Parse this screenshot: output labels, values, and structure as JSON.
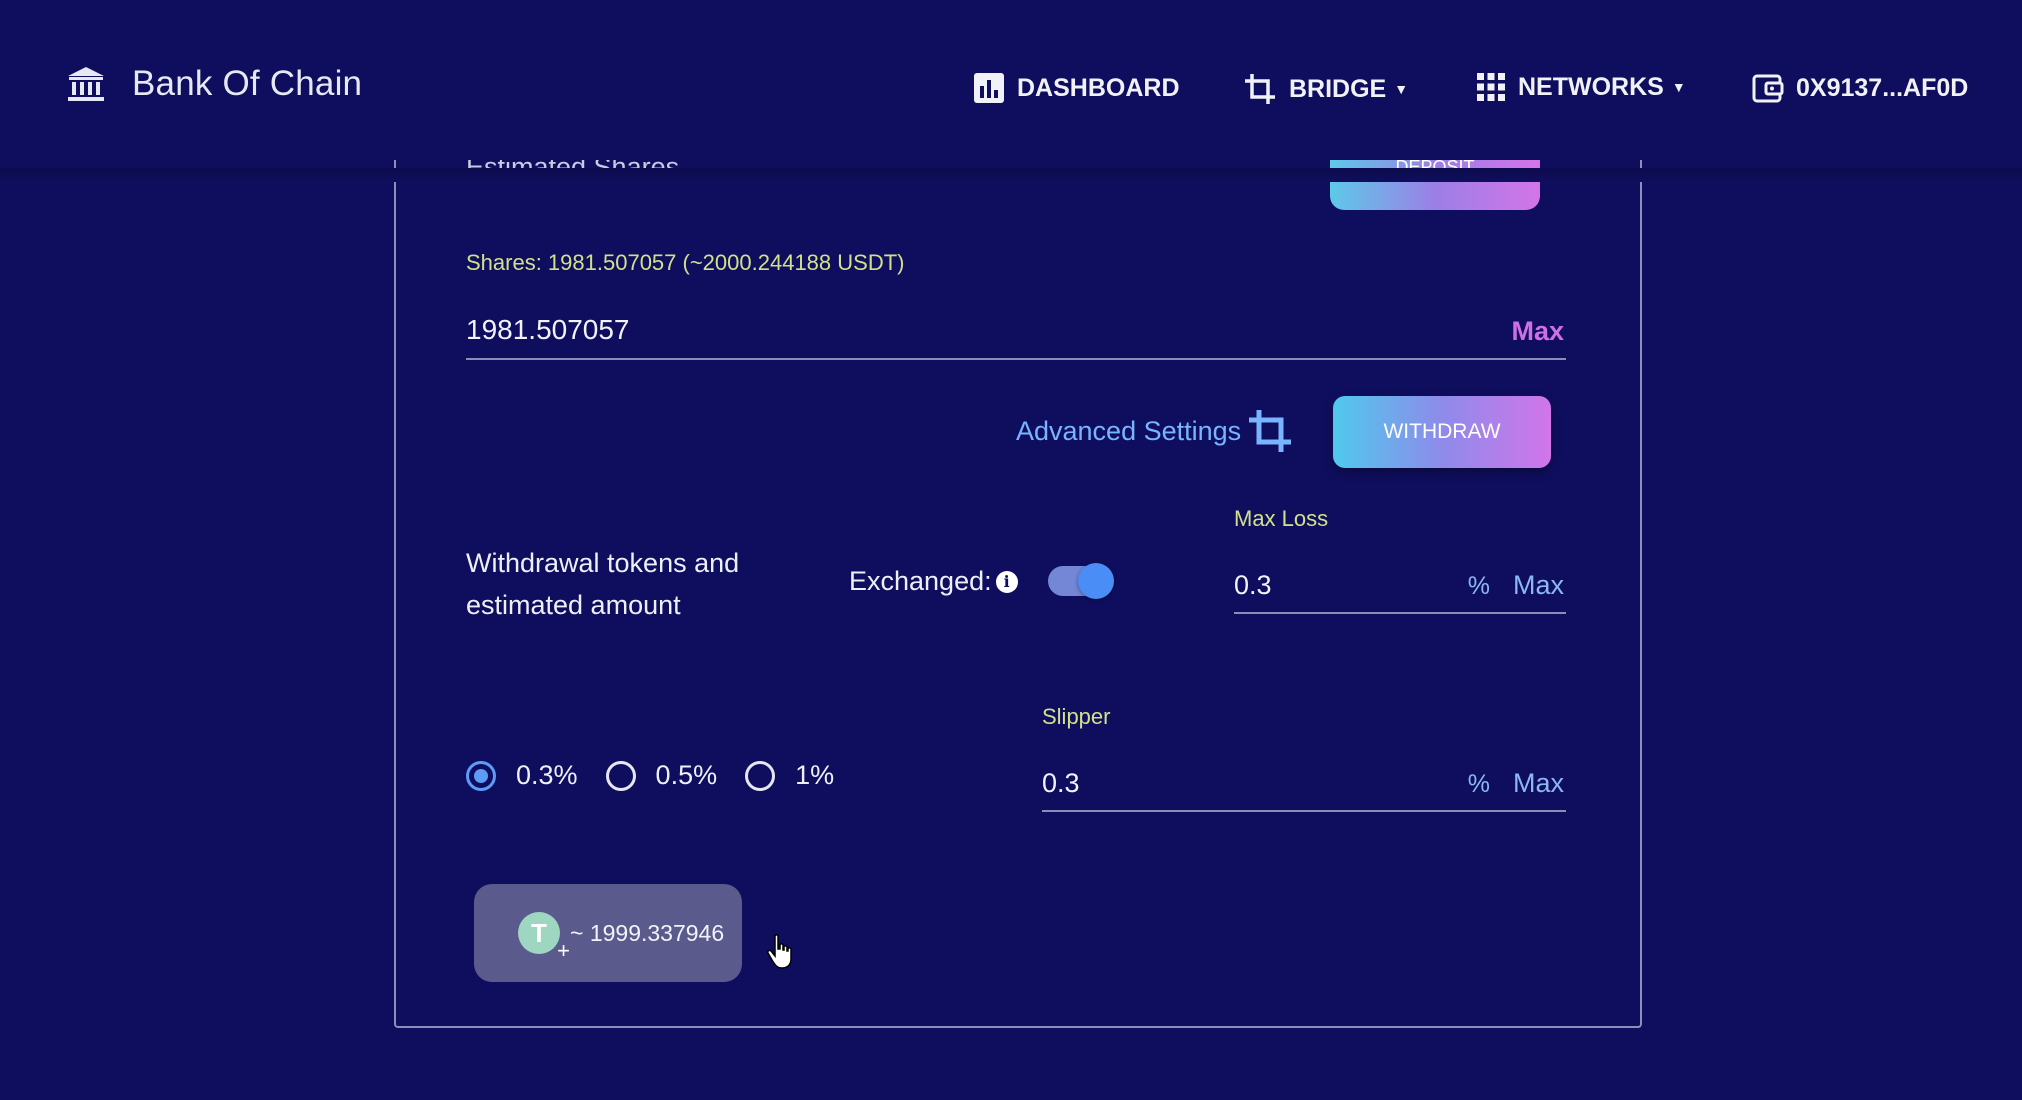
{
  "brand": {
    "name": "Bank Of Chain",
    "icon": "bank-icon"
  },
  "nav": {
    "dashboard": "DASHBOARD",
    "bridge": "BRIDGE",
    "networks": "NETWORKS",
    "wallet": "0X9137...AF0D"
  },
  "top_cut": {
    "estimated_shares_label": "Estimated Shares",
    "deposit_label": "DEPOSIT"
  },
  "withdraw": {
    "shares_text": "Shares: 1981.507057 (~2000.244188 USDT)",
    "amount_value": "1981.507057",
    "amount_max": "Max",
    "advanced_settings": "Advanced Settings",
    "withdraw_button": "WITHDRAW",
    "tokens_label_line1": "Withdrawal tokens and",
    "tokens_label_line2": "estimated amount",
    "exchanged_label": "Exchanged:",
    "exchanged_on": true,
    "max_loss": {
      "label": "Max Loss",
      "value": "0.3",
      "unit": "%",
      "max": "Max"
    },
    "slipper": {
      "label": "Slipper",
      "value": "0.3",
      "unit": "%",
      "max": "Max"
    },
    "slippage_options": [
      "0.3%",
      "0.5%",
      "1%"
    ],
    "selected_slippage": "0.3%",
    "token_estimate": "~ 1999.337946",
    "token_icon": "usdt-icon"
  },
  "colors": {
    "background": "#0f0e5e",
    "accent_blue": "#78b4ff",
    "label_green": "#d2e08a",
    "max_pink": "#cf6fe6"
  }
}
